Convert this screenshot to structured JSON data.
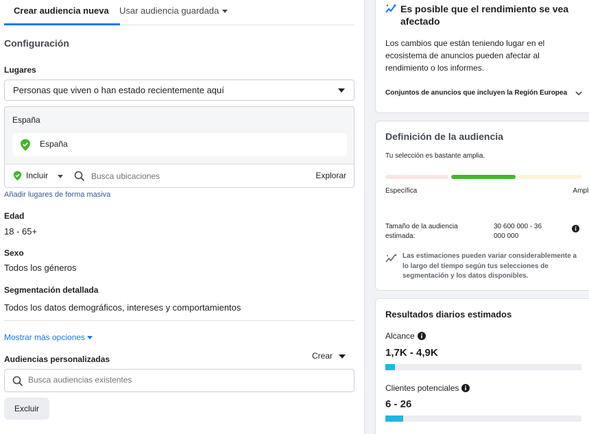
{
  "tabs": {
    "new_audience": "Crear audiencia nueva",
    "saved_audience": "Usar audiencia guardada"
  },
  "config": {
    "title": "Configuración",
    "places_label": "Lugares",
    "places_select": "Personas que viven o han estado recientemente aquí",
    "location_header": "España",
    "location_chip": "España",
    "include_label": "Incluir",
    "search_locations_placeholder": "Busca ubicaciones",
    "explore_label": "Explorar",
    "bulk_link": "Añadir lugares de forma masiva",
    "age_label": "Edad",
    "age_value": "18 - 65+",
    "sex_label": "Sexo",
    "sex_value": "Todos los géneros",
    "detailed_label": "Segmentación detallada",
    "detailed_value": "Todos los datos demográficos, intereses y comportamientos",
    "more_options": "Mostrar más opciones",
    "custom_audiences_label": "Audiencias personalizadas",
    "create_label": "Crear",
    "search_audiences_placeholder": "Busca audiencias existentes",
    "exclude_button": "Excluir"
  },
  "performance_card": {
    "title": "Es posible que el rendimiento se vea afectado",
    "body": "Los cambios que están teniendo lugar en el ecosistema de anuncios pueden afectar al rendimiento o los informes.",
    "footer": "Conjuntos de anuncios que incluyen la Región Europea"
  },
  "audience_definition": {
    "title": "Definición de la audiencia",
    "subtitle": "Tu selección es bastante amplia.",
    "specific_label": "Específica",
    "broad_label": "Amplia",
    "size_label": "Tamaño de la audiencia estimada:",
    "size_value": "30 600 000 - 36 000 000",
    "note": "Las estimaciones pueden variar considerablemente a lo largo del tiempo según tus selecciones de segmentación y los datos disponibles."
  },
  "daily_results": {
    "title": "Resultados diarios estimados",
    "reach_label": "Alcance",
    "reach_value": "1,7K - 4,9K",
    "reach_fill_fraction": 0.05,
    "leads_label": "Clientes potenciales",
    "leads_value": "6 - 26",
    "leads_fill_fraction": 0.09
  },
  "colors": {
    "accent_blue": "#1877f2",
    "meter_green": "#42b72a",
    "result_bar": "#1fb6e4",
    "pin_green": "#42b72a"
  }
}
